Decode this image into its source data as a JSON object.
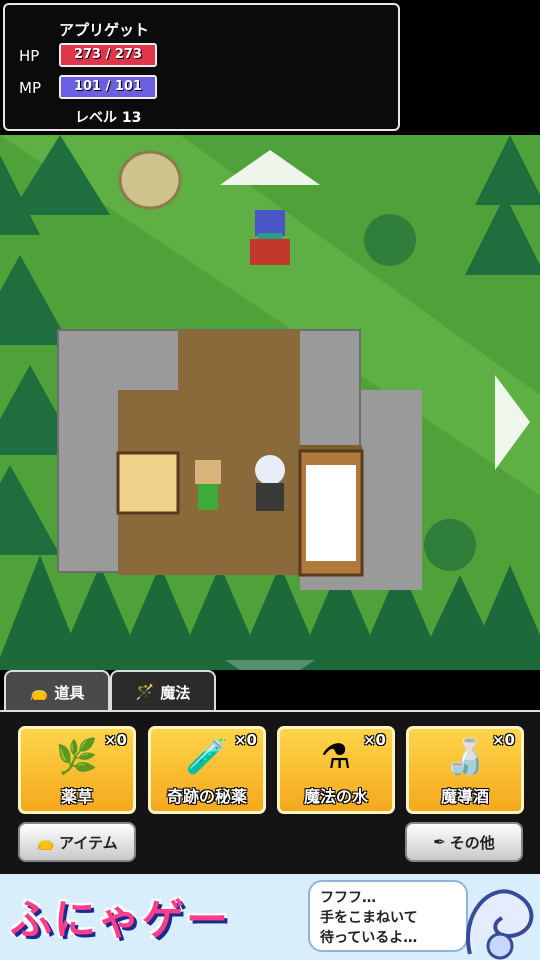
{
  "status": {
    "name": "アプリゲット",
    "hp_label": "HP",
    "hp_text": "273 / 273",
    "mp_label": "MP",
    "mp_text": "101 / 101",
    "level_text": "レベル 13",
    "hp_fraction": 1.0,
    "mp_fraction": 1.0,
    "hp_color": "#e0344a",
    "mp_color": "#6a5fe0"
  },
  "tabs": [
    {
      "label": "道具",
      "icon": "item-bag-icon"
    },
    {
      "label": "魔法",
      "icon": "magic-wand-icon"
    }
  ],
  "items": [
    {
      "name": "薬草",
      "count": "×0",
      "icon": "herb-icon"
    },
    {
      "name": "奇跡の秘薬",
      "count": "×0",
      "icon": "green-potion-icon"
    },
    {
      "name": "魔法の水",
      "count": "×0",
      "icon": "magic-water-icon"
    },
    {
      "name": "魔導酒",
      "count": "×0",
      "icon": "magic-wine-icon"
    }
  ],
  "buttons": {
    "item_label": "アイテム",
    "other_label": "その他"
  },
  "ad": {
    "logo": "ふにゃゲー",
    "line1": "フフフ…",
    "line2": "手をこまねいて",
    "line3": "待っているよ…"
  }
}
